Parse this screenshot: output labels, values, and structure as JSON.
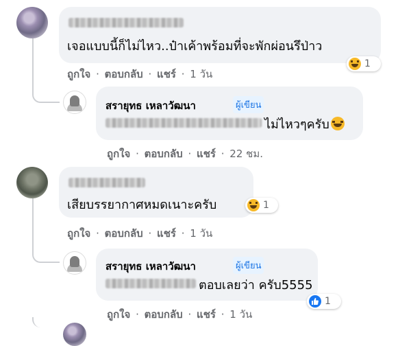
{
  "comments": [
    {
      "text": "เจอแบบนี้ก็ไม่ไหว..ป๋าเค้าพร้อมที่จะพักผ่อนรึป่าว",
      "actions": {
        "like": "ถูกใจ",
        "reply": "ตอบกลับ",
        "share": "แชร์",
        "time": "1 วัน"
      },
      "reaction": {
        "type": "haha",
        "count": "1"
      }
    },
    {
      "author": "สรายุทธ เหลาวัฒนา",
      "badge": "ผู้เขียน",
      "text": "ไม่ไหวๆครับ",
      "actions": {
        "like": "ถูกใจ",
        "reply": "ตอบกลับ",
        "share": "แชร์",
        "time": "22 ชม."
      }
    },
    {
      "text": "เสียบรรยากาศหมดเนาะครับ",
      "actions": {
        "like": "ถูกใจ",
        "reply": "ตอบกลับ",
        "share": "แชร์",
        "time": "1 วัน"
      },
      "reaction": {
        "type": "haha",
        "count": "1"
      }
    },
    {
      "author": "สรายุทธ เหลาวัฒนา",
      "badge": "ผู้เขียน",
      "text": "ตอบเลยว่า ครับ5555",
      "actions": {
        "like": "ถูกใจ",
        "reply": "ตอบกลับ",
        "share": "แชร์",
        "time": "1 วัน"
      },
      "reaction": {
        "type": "like",
        "count": "1"
      }
    }
  ],
  "separator": "·",
  "colors": {
    "bubble": "#f0f2f5",
    "meta": "#65676b",
    "accent": "#1b74e4",
    "haha": "#f7b928",
    "like": "#1877f2"
  }
}
